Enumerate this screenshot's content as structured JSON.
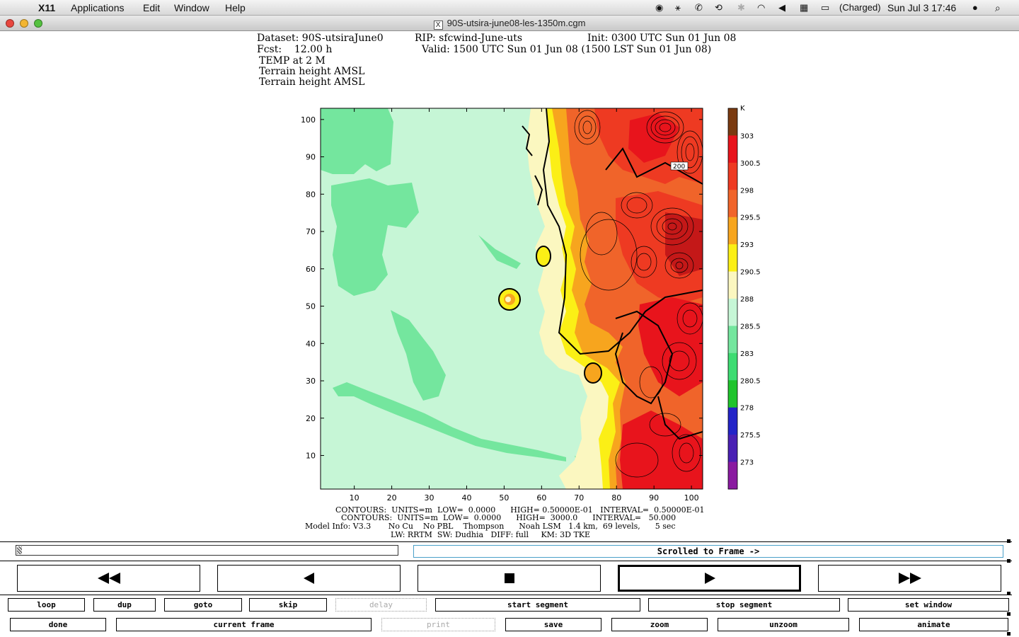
{
  "menubar": {
    "app": "X11",
    "items": [
      "Applications",
      "Edit",
      "Window",
      "Help"
    ],
    "battery": "(Charged)",
    "clock": "Sun Jul 3  17:46"
  },
  "window": {
    "title": "90S-utsira-june08-les-1350m.cgm"
  },
  "header": {
    "dataset": "Dataset: 90S-utsiraJune0",
    "rip": "RIP: sfcwind-June-uts",
    "init": "Init: 0300 UTC Sun 01 Jun 08",
    "fcst": "Fcst:    12.00 h",
    "valid": "Valid: 1500 UTC Sun 01 Jun 08 (1500 LST Sun 01 Jun 08)",
    "field1": "TEMP at 2 M",
    "field2": "Terrain height AMSL",
    "field3": "Terrain height AMSL"
  },
  "chart_data": {
    "type": "heatmap",
    "x_ticks": [
      10,
      20,
      30,
      40,
      50,
      60,
      70,
      80,
      90,
      100
    ],
    "y_ticks": [
      10,
      20,
      30,
      40,
      50,
      60,
      70,
      80,
      90,
      100
    ],
    "xlim": [
      1,
      103
    ],
    "ylim": [
      1,
      103
    ],
    "colorbar_unit": "K",
    "colorbar_labels": [
      "303",
      "300.5",
      "298",
      "295.5",
      "293",
      "290.5",
      "288",
      "285.5",
      "283",
      "280.5",
      "278",
      "275.5",
      "273"
    ],
    "colorbar_colors": [
      "#7a3a10",
      "#e8141c",
      "#ee3a22",
      "#f0642a",
      "#f7a51e",
      "#fbef16",
      "#fbf7c0",
      "#c6f6d6",
      "#74e69e",
      "#3ddc72",
      "#1fc42c",
      "#2324c8",
      "#4a20b4",
      "#8a1aa0"
    ],
    "contour_label": "200"
  },
  "footer": {
    "line1": "CONTOURS:  UNITS=m  LOW=  0.0000      HIGH= 0.50000E-01   INTERVAL=  0.50000E-01",
    "line2": "CONTOURS:  UNITS=m  LOW=  0.0000      HIGH=  3000.0      INTERVAL=   50.000",
    "line3": "Model Info: V3.3       No Cu    No PBL    Thompson      Noah LSM   1.4 km,  69 levels,      5 sec",
    "line4": "LW: RRTM  SW: Dudhia   DIFF: full     KM: 3D TKE"
  },
  "controls": {
    "frame_status": "Scrolled to Frame ->",
    "row1": [
      "loop",
      "dup",
      "goto",
      "skip",
      "delay",
      "start segment",
      "stop segment",
      "set window"
    ],
    "row2": [
      "done",
      "current frame",
      "print",
      "save",
      "zoom",
      "unzoom",
      "animate"
    ]
  }
}
